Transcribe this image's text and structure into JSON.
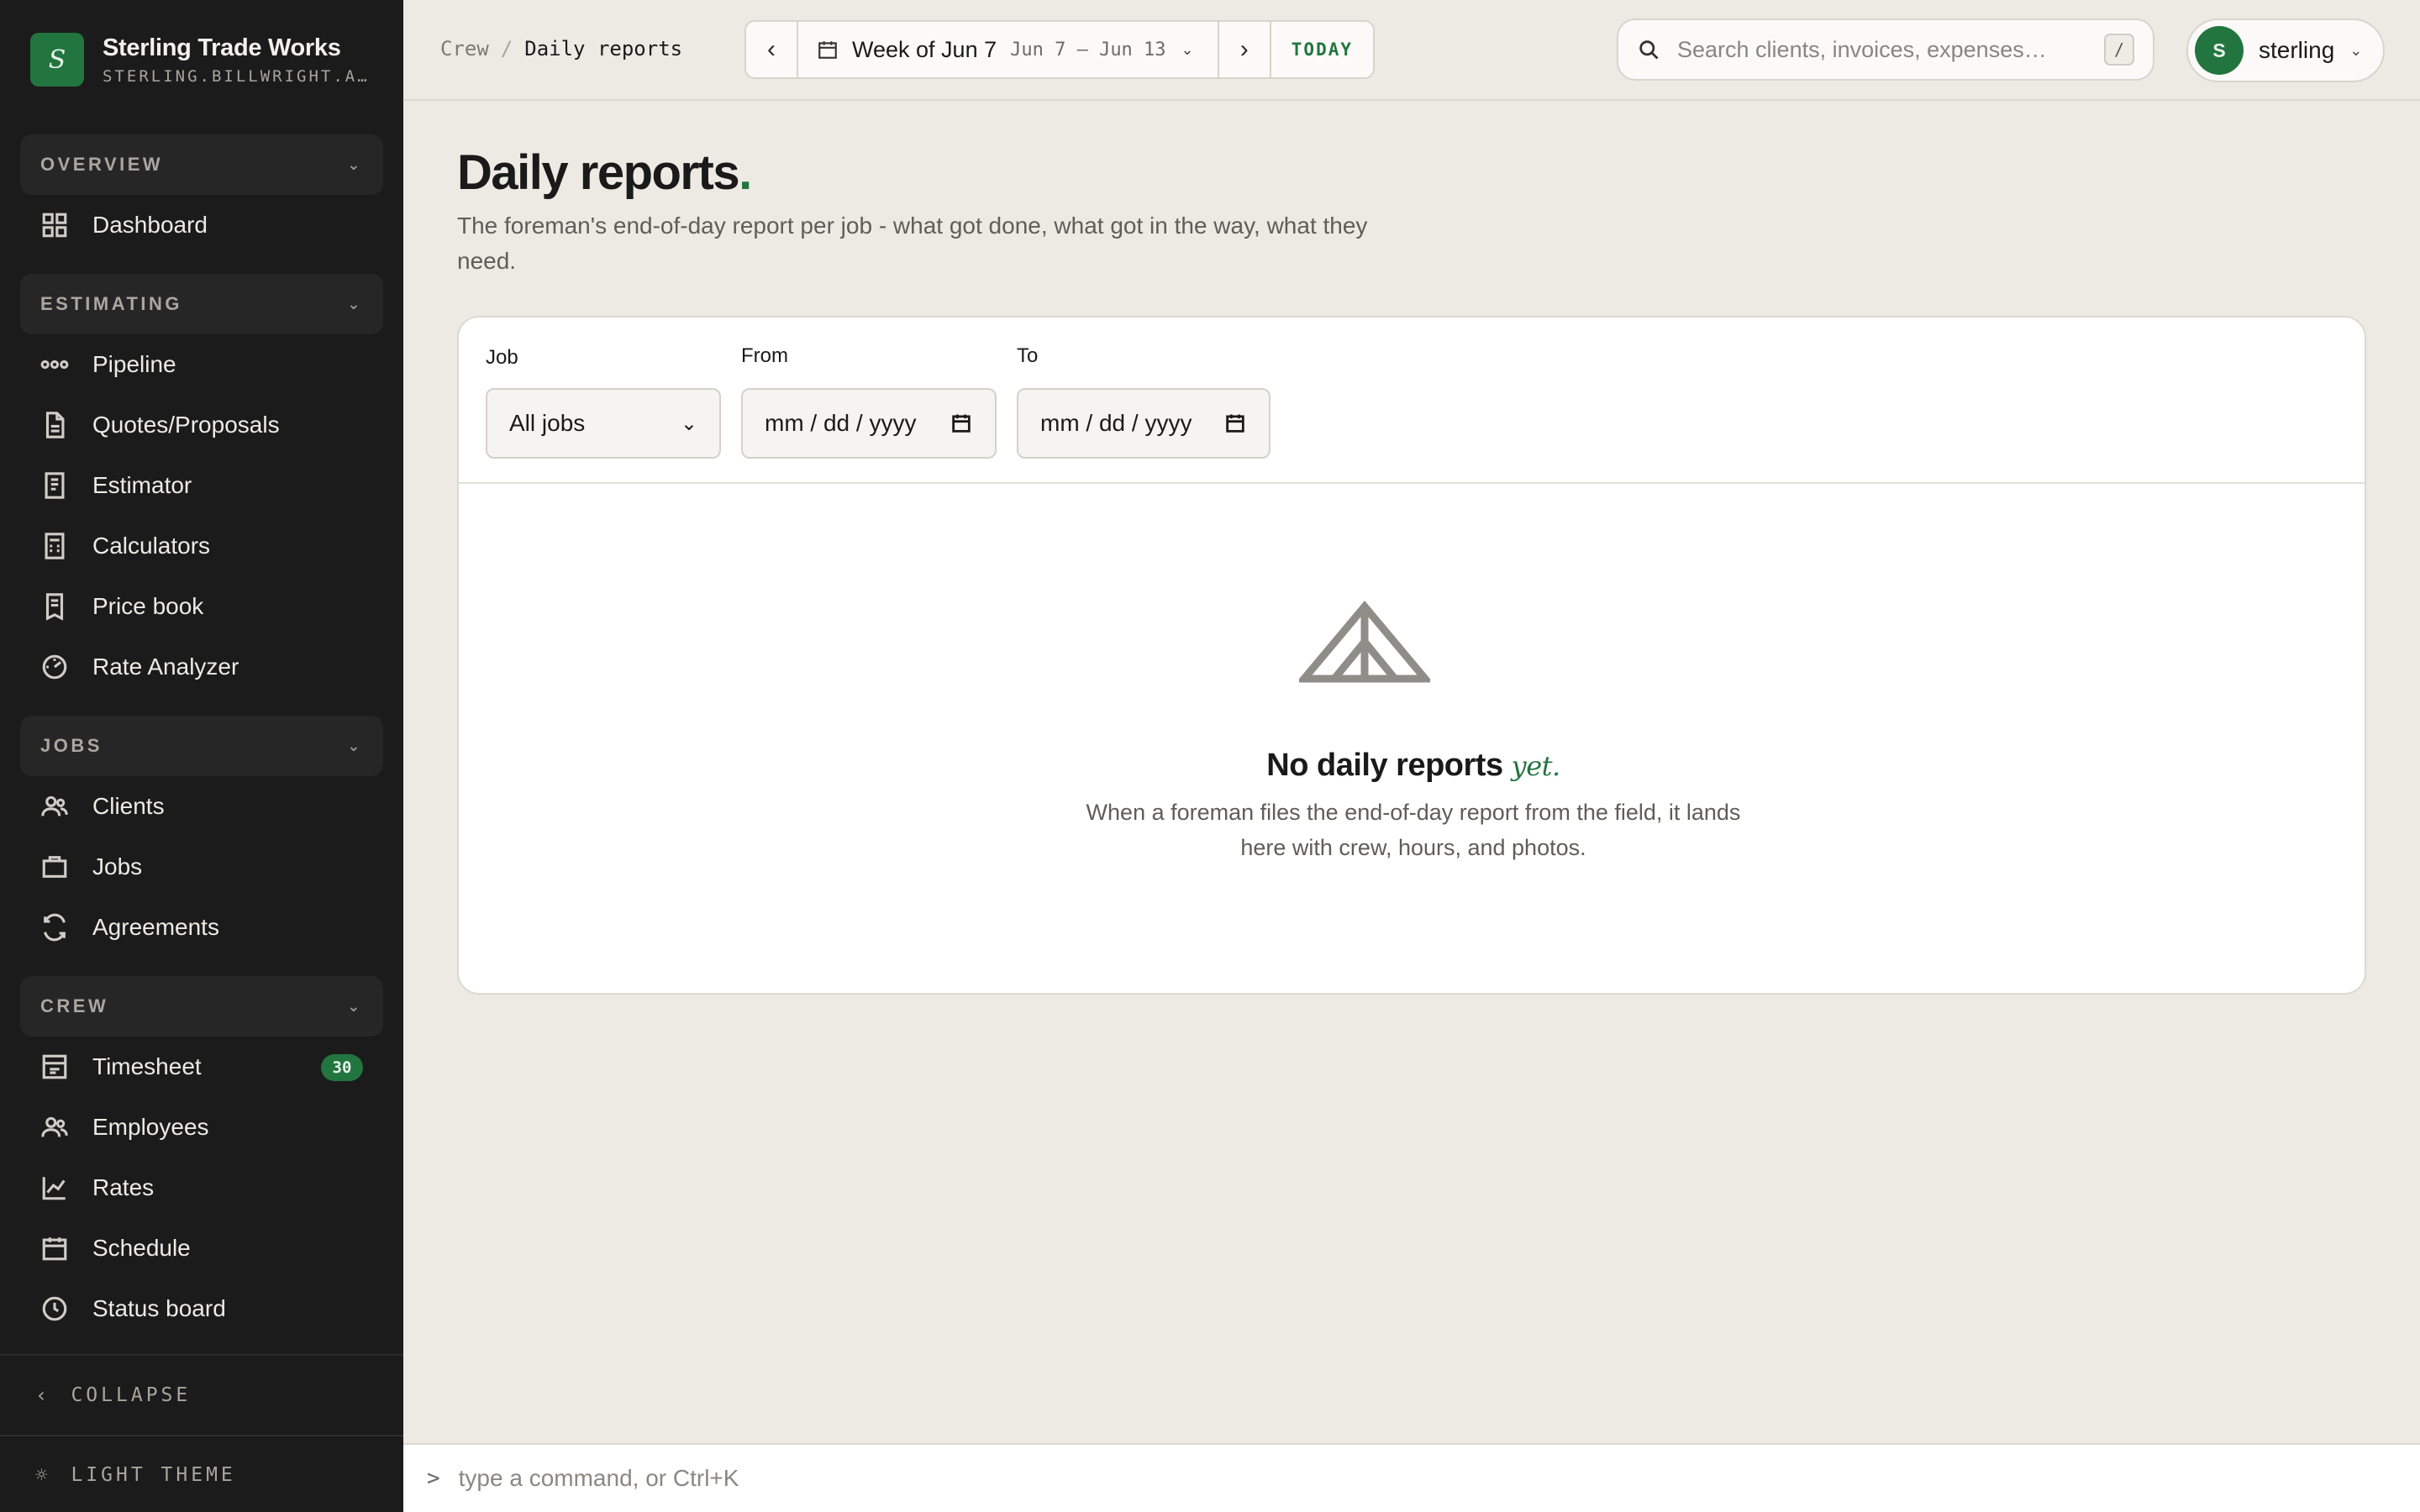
{
  "brand": {
    "logo_letter": "S",
    "name": "Sterling Trade Works",
    "subdomain": "STERLING.BILLWRIGHT.APP"
  },
  "sidebar": {
    "groups": [
      {
        "label": "OVERVIEW",
        "items": [
          {
            "label": "Dashboard",
            "icon": "grid-icon"
          }
        ]
      },
      {
        "label": "ESTIMATING",
        "items": [
          {
            "label": "Pipeline",
            "icon": "pipeline-icon"
          },
          {
            "label": "Quotes/Proposals",
            "icon": "document-icon"
          },
          {
            "label": "Estimator",
            "icon": "receipt-icon"
          },
          {
            "label": "Calculators",
            "icon": "calculator-icon"
          },
          {
            "label": "Price book",
            "icon": "book-icon"
          },
          {
            "label": "Rate Analyzer",
            "icon": "gauge-icon"
          }
        ]
      },
      {
        "label": "JOBS",
        "items": [
          {
            "label": "Clients",
            "icon": "users-icon"
          },
          {
            "label": "Jobs",
            "icon": "briefcase-icon"
          },
          {
            "label": "Agreements",
            "icon": "refresh-icon"
          }
        ]
      },
      {
        "label": "CREW",
        "items": [
          {
            "label": "Timesheet",
            "icon": "timesheet-icon",
            "badge": "30"
          },
          {
            "label": "Employees",
            "icon": "users-icon"
          },
          {
            "label": "Rates",
            "icon": "chart-icon"
          },
          {
            "label": "Schedule",
            "icon": "calendar-icon"
          },
          {
            "label": "Status board",
            "icon": "clock-icon"
          }
        ]
      }
    ],
    "collapse_label": "COLLAPSE",
    "theme_label": "LIGHT THEME"
  },
  "topbar": {
    "breadcrumb_parent": "Crew",
    "breadcrumb_sep": "/",
    "breadcrumb_current": "Daily reports",
    "week_title": "Week of Jun 7",
    "week_range": "Jun 7 – Jun 13",
    "today_label": "TODAY",
    "search_placeholder": "Search clients, invoices, expenses…",
    "search_shortcut": "/",
    "user_initial": "S",
    "user_name": "sterling"
  },
  "page": {
    "title": "Daily reports",
    "title_dot": ".",
    "subtitle": "The foreman's end-of-day report per job - what got done, what got in the way, what they need."
  },
  "filters": {
    "job_label": "Job",
    "job_value": "All jobs",
    "from_label": "From",
    "from_placeholder": "mm / dd / yyyy",
    "to_label": "To",
    "to_placeholder": "mm / dd / yyyy"
  },
  "empty_state": {
    "title": "No daily reports",
    "title_accent": "yet.",
    "description": "When a foreman files the end-of-day report from the field, it lands here with crew, hours, and photos."
  },
  "command_bar": {
    "prompt": ">",
    "placeholder": "type a command, or Ctrl+K"
  },
  "colors": {
    "accent": "#23753f",
    "sidebar_bg": "#1b1b1b",
    "page_bg": "#edeae4",
    "card_bg": "#ffffff"
  }
}
